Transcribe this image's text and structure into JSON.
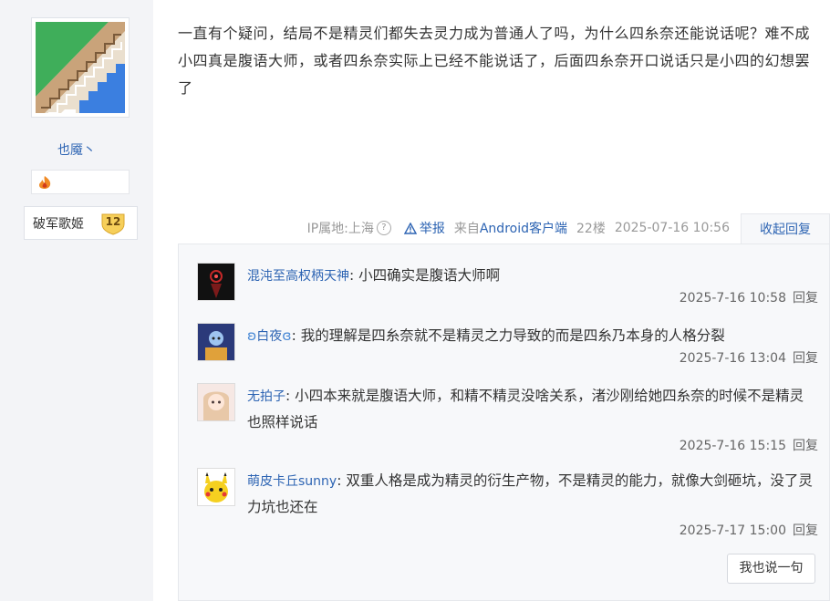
{
  "author": {
    "name": "也魇丶",
    "badge_name": "破军歌姬",
    "badge_level": "12"
  },
  "post": {
    "content": "一直有个疑问，结局不是精灵们都失去灵力成为普通人了吗，为什么四糸奈还能说话呢？难不成小四真是腹语大师，或者四糸奈实际上已经不能说话了，后面四糸奈开口说话只是小四的幻想罢了",
    "ip_label": "IP属地:上海",
    "report_label": "举报",
    "source_prefix": "来自",
    "source_client": "Android客户端",
    "floor": "22楼",
    "timestamp": "2025-07-16 10:56",
    "collapse_label": "收起回复"
  },
  "replies": [
    {
      "user": "混沌至高权柄天神",
      "text": "小四确实是腹语大师啊",
      "time": "2025-7-16 10:58",
      "reply_label": "回复"
    },
    {
      "user": "白夜",
      "text": "我的理解是四糸奈就不是精灵之力导致的而是四糸乃本身的人格分裂",
      "time": "2025-7-16 13:04",
      "reply_label": "回复"
    },
    {
      "user": "无拍子",
      "text": "小四本来就是腹语大师，和精不精灵没啥关系，渚沙刚给她四糸奈的时候不是精灵也照样说话",
      "time": "2025-7-16 15:15",
      "reply_label": "回复"
    },
    {
      "user": "萌皮卡丘sunny",
      "text": "双重人格是成为精灵的衍生产物，不是精灵的能力，就像大剑砸坑，没了灵力坑也还在",
      "time": "2025-7-17 15:00",
      "reply_label": "回复"
    }
  ],
  "say_button": "我也说一句",
  "colors": {
    "link_blue": "#2d64b3",
    "sidebar_bg": "#f3f4f7",
    "panel_bg": "#f7f8fa"
  }
}
